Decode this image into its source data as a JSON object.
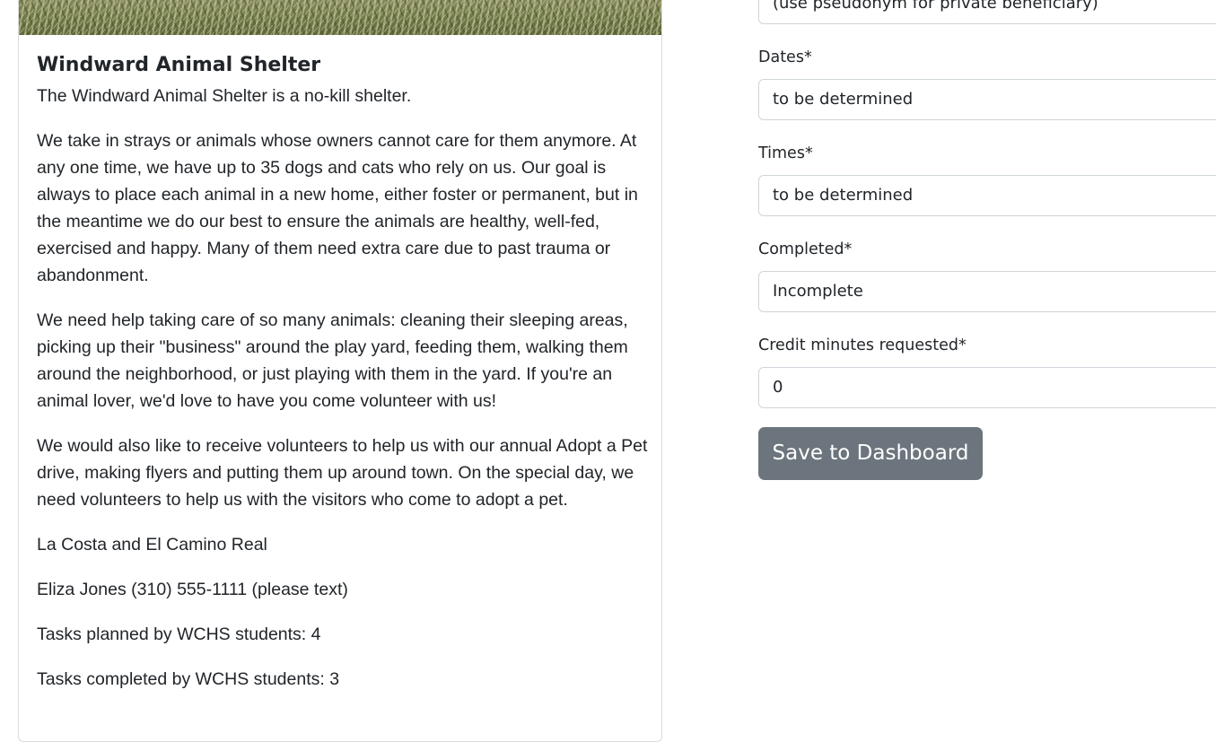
{
  "shelter_card": {
    "title": "Windward Animal Shelter",
    "intro": "The Windward Animal Shelter is a no-kill shelter.",
    "paragraphs": [
      "We take in strays or animals whose owners cannot care for them anymore. At any one time, we have up to 35 dogs and cats who rely on us. Our goal is always to place each animal in a new home, either foster or permanent, but in the meantime we do our best to ensure the animals are healthy, well-fed, exercised and happy. Many of them need extra care due to past trauma or abandonment.",
      "We need help taking care of so many animals: cleaning their sleeping areas, picking up their \"business\" around the play yard, feeding them, walking them around the neighborhood, or just playing with them in the yard. If you're an animal lover, we'd love to have you come volunteer with us!",
      "We would also like to receive volunteers to help us with our annual Adopt a Pet drive, making flyers and putting them up around town. On the special day, we need volunteers to help us with the visitors who come to adopt a pet."
    ],
    "location": "La Costa and El Camino Real",
    "contact": "Eliza Jones (310) 555-1111 (please text)",
    "tasks_planned": "Tasks planned by WCHS students: 4",
    "tasks_completed": "Tasks completed by WCHS students: 3"
  },
  "form": {
    "beneficiary_placeholder": "(use pseudonym for private beneficiary)",
    "dates": {
      "label": "Dates*",
      "value": "to be determined"
    },
    "times": {
      "label": "Times*",
      "value": "to be determined"
    },
    "completed": {
      "label": "Completed*",
      "value": "Incomplete"
    },
    "credit_minutes": {
      "label": "Credit minutes requested*",
      "value": "0"
    },
    "save_label": "Save to Dashboard"
  },
  "colors": {
    "button_bg": "#6c757d",
    "button_text": "#ffffff",
    "input_border": "#ced4da",
    "card_border": "#dcdcdc",
    "text": "#212529"
  }
}
